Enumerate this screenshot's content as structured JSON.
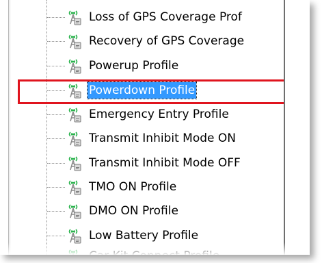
{
  "tree": {
    "items": [
      {
        "label": "Loss of GPS Coverage Prof",
        "icon": "profile-antenna-icon",
        "selected": false
      },
      {
        "label": "Recovery of GPS Coverage",
        "icon": "profile-antenna-icon",
        "selected": false
      },
      {
        "label": "Powerup Profile",
        "icon": "profile-antenna-icon",
        "selected": false
      },
      {
        "label": "Powerdown Profile",
        "icon": "profile-antenna-icon",
        "selected": true
      },
      {
        "label": "Emergency Entry Profile",
        "icon": "profile-antenna-icon",
        "selected": false
      },
      {
        "label": "Transmit Inhibit Mode ON",
        "icon": "profile-antenna-icon",
        "selected": false
      },
      {
        "label": "Transmit Inhibit Mode OFF",
        "icon": "profile-antenna-icon",
        "selected": false
      },
      {
        "label": "TMO ON Profile",
        "icon": "profile-antenna-icon",
        "selected": false
      },
      {
        "label": "DMO ON Profile",
        "icon": "profile-antenna-icon",
        "selected": false
      },
      {
        "label": "Low Battery Profile",
        "icon": "profile-antenna-icon",
        "selected": false
      },
      {
        "label": "Car Kit Connect Profile",
        "icon": "profile-antenna-icon",
        "selected": false
      }
    ]
  },
  "colors": {
    "selection": "#3399ff",
    "highlight_border": "#e0141e",
    "icon_wave": "#27b24a",
    "icon_body": "#8a8a8a"
  }
}
